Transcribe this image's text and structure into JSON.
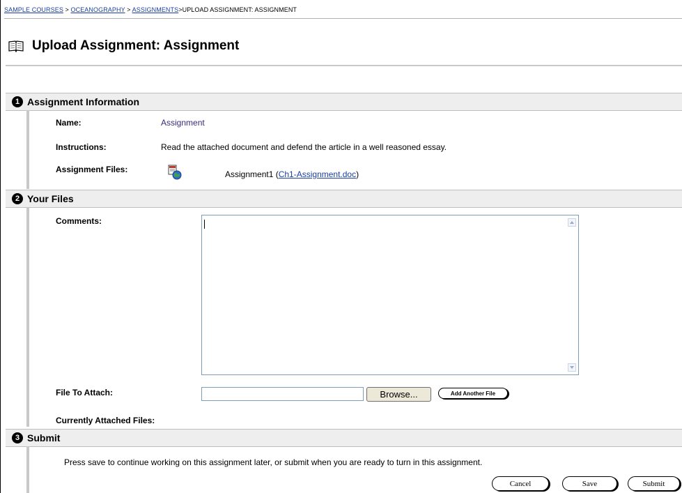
{
  "breadcrumb": {
    "items": [
      "SAMPLE COURSES",
      "OCEANOGRAPHY",
      "ASSIGNMENTS"
    ],
    "separator": " > ",
    "current": ">UPLOAD ASSIGNMENT: ASSIGNMENT"
  },
  "page": {
    "title": "Upload Assignment: Assignment",
    "icon": "open-book-icon"
  },
  "sections": [
    {
      "number": "1",
      "title": "Assignment Information"
    },
    {
      "number": "2",
      "title": "Your Files"
    },
    {
      "number": "3",
      "title": "Submit"
    }
  ],
  "assignment_info": {
    "name_label": "Name:",
    "name_value": "Assignment",
    "instructions_label": "Instructions:",
    "instructions_value": "Read the attached document and defend the article in a well reasoned essay.",
    "files_label": "Assignment Files:",
    "file_name": "Assignment1",
    "file_open_paren": "(",
    "file_link": "Ch1-Assignment.doc",
    "file_close_paren": ")",
    "file_icon": "web-document-icon"
  },
  "your_files": {
    "comments_label": "Comments:",
    "comments_value": "",
    "attach_label": "File To Attach:",
    "attach_value": "",
    "browse_label": "Browse...",
    "add_another_label": "Add Another File",
    "currently_attached_label": "Currently Attached Files:"
  },
  "submit": {
    "instructions": "Press save to continue working on this assignment later, or submit when you are ready to turn in this assignment.",
    "cancel_label": "Cancel",
    "save_label": "Save",
    "submit_label": "Submit"
  },
  "colors": {
    "link": "#1a3fa0",
    "name_value": "#3a2a78",
    "section_bg": "#eeeeee",
    "section_border": "#bdbdbd"
  }
}
